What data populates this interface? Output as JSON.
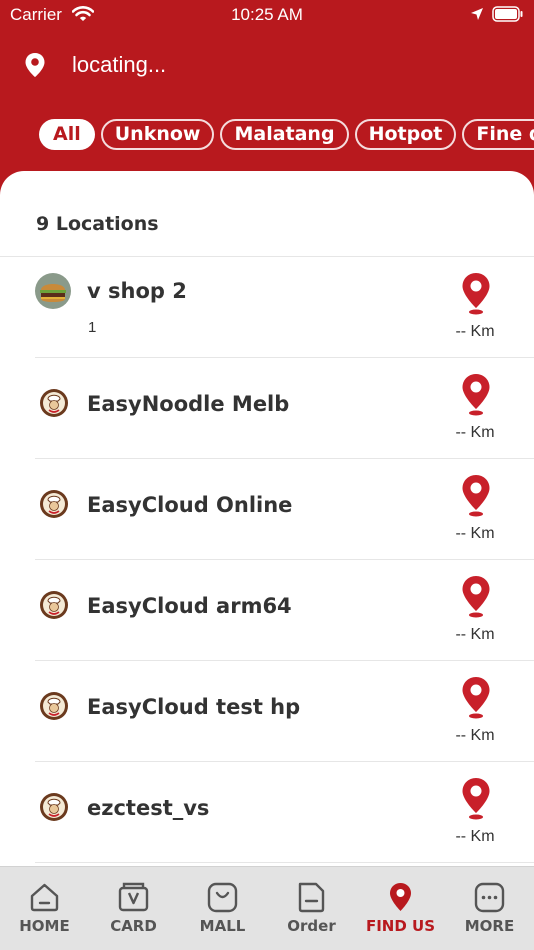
{
  "status": {
    "carrier": "Carrier",
    "time": "10:25 AM"
  },
  "location": {
    "text": "locating..."
  },
  "categories": [
    "All",
    "Unknow",
    "Malatang",
    "Hotpot",
    "Fine di"
  ],
  "list": {
    "count_label": "9 Locations",
    "items": [
      {
        "name": "v shop 2",
        "sub": "1",
        "distance": "-- Km",
        "avatar": "burger"
      },
      {
        "name": "EasyNoodle Melb",
        "sub": "",
        "distance": "-- Km",
        "avatar": "chef-logo"
      },
      {
        "name": "EasyCloud Online",
        "sub": "",
        "distance": "-- Km",
        "avatar": "chef-logo"
      },
      {
        "name": "EasyCloud arm64",
        "sub": "",
        "distance": "-- Km",
        "avatar": "chef-logo"
      },
      {
        "name": "EasyCloud test hp",
        "sub": "",
        "distance": "-- Km",
        "avatar": "chef-logo"
      },
      {
        "name": "ezctest_vs",
        "sub": "",
        "distance": "-- Km",
        "avatar": "chef-logo"
      }
    ]
  },
  "tabs": [
    {
      "label": "HOME",
      "icon": "home-icon"
    },
    {
      "label": "CARD",
      "icon": "card-icon"
    },
    {
      "label": "MALL",
      "icon": "mall-icon"
    },
    {
      "label": "Order",
      "icon": "order-icon"
    },
    {
      "label": "FIND US",
      "icon": "find-us-icon",
      "active": true
    },
    {
      "label": "MORE",
      "icon": "more-icon"
    }
  ],
  "colors": {
    "brand": "#b8191e",
    "tab_bg": "#e3e3e3",
    "text": "#333333"
  }
}
